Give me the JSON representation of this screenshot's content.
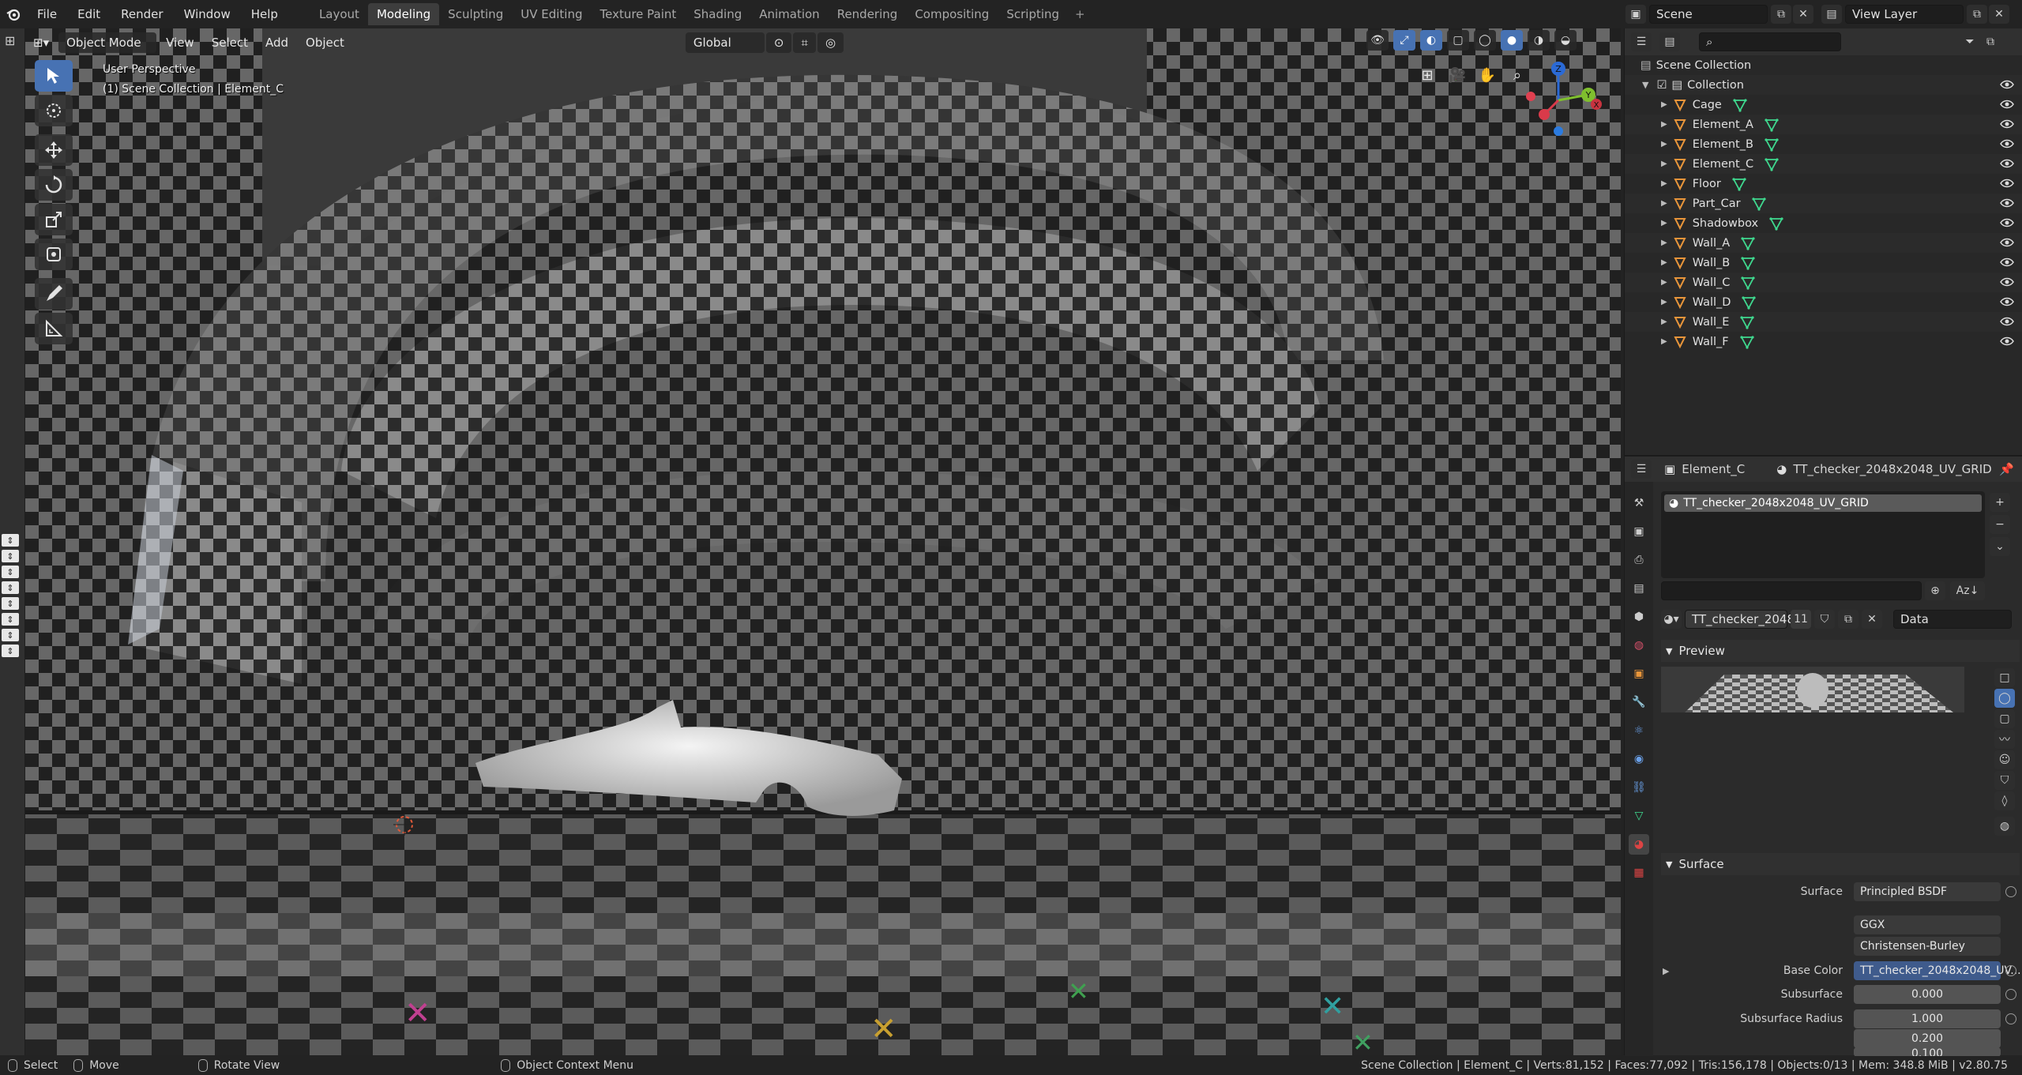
{
  "menu": [
    "File",
    "Edit",
    "Render",
    "Window",
    "Help"
  ],
  "workspaces": [
    "Layout",
    "Modeling",
    "Sculpting",
    "UV Editing",
    "Texture Paint",
    "Shading",
    "Animation",
    "Rendering",
    "Compositing",
    "Scripting"
  ],
  "active_workspace": "Modeling",
  "scene_name": "Scene",
  "view_layer": "View Layer",
  "viewport": {
    "mode": "Object Mode",
    "menus": [
      "View",
      "Select",
      "Add",
      "Object"
    ],
    "orientation": "Global",
    "info_line1": "User Perspective",
    "info_line2": "(1) Scene Collection | Element_C",
    "gizmo_axes": {
      "x": "X",
      "y": "Y",
      "z": "Z"
    }
  },
  "outliner": {
    "search_placeholder": "",
    "root": "Scene Collection",
    "collection": "Collection",
    "objects": [
      "Cage",
      "Element_A",
      "Element_B",
      "Element_C",
      "Floor",
      "Part_Car",
      "Shadowbox",
      "Wall_A",
      "Wall_B",
      "Wall_C",
      "Wall_D",
      "Wall_E",
      "Wall_F"
    ],
    "selected_object": "Element_C"
  },
  "properties": {
    "object": "Element_C",
    "material": "TT_checker_2048x2048_UV_GRID",
    "slot": "TT_checker_2048x2048_UV_GRID",
    "material_short": "TT_checker_2048..",
    "users": "11",
    "link": "Data",
    "preview_title": "Preview",
    "surface_title": "Surface",
    "surface_label": "Surface",
    "surface_value": "Principled BSDF",
    "distribution": "GGX",
    "subsurface_method": "Christensen-Burley",
    "base_color_label": "Base Color",
    "base_color_value": "TT_checker_2048x2048_UV...",
    "subsurface_label": "Subsurface",
    "subsurface_value": "0.000",
    "subsurface_radius_label": "Subsurface Radius",
    "subsurface_radius": [
      "1.000",
      "0.200",
      "0.100"
    ]
  },
  "statusbar": {
    "select": "Select",
    "move": "Move",
    "rotate": "Rotate View",
    "context": "Object Context Menu",
    "stats": "Scene Collection | Element_C | Verts:81,152 | Faces:77,092 | Tris:156,178 | Objects:0/13 | Mem: 348.8 MiB | v2.80.75"
  },
  "colors": {
    "accent": "#4772b3",
    "object_icon": "#e8953a",
    "mesh_icon": "#3fd98f"
  }
}
